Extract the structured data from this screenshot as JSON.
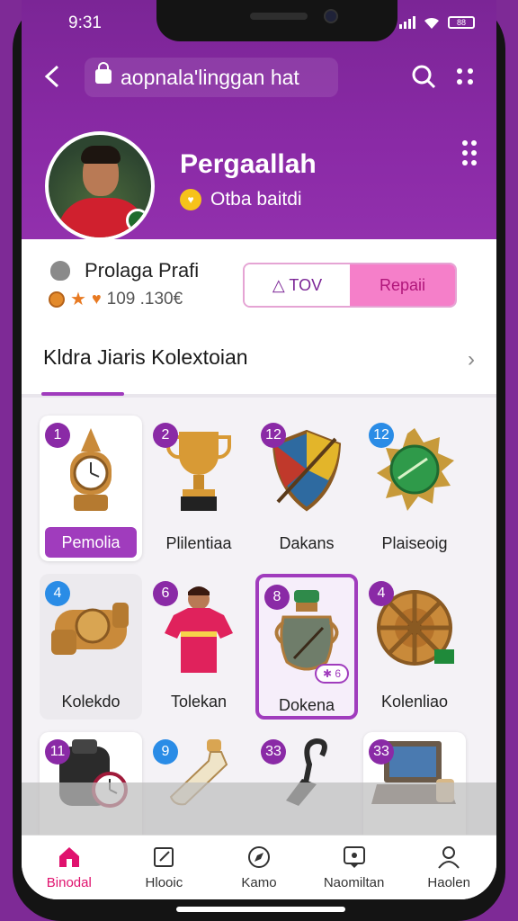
{
  "status_bar": {
    "time": "9:31",
    "battery": "88"
  },
  "browser": {
    "url": "aopnala'linggan hat"
  },
  "profile": {
    "name": "Pergaallah",
    "subtitle": "Otba baitdi"
  },
  "info": {
    "title": "Prolaga Prafi",
    "stats": "109 .130€",
    "button_tov": "TOV",
    "button_repair": "Repaii"
  },
  "section": {
    "title": "Kldra Jiaris Kolextoian"
  },
  "items": [
    {
      "num": "1",
      "label": "Pemolia",
      "badge_color": "#8a2aa6",
      "icon": "clock-trophy-icon"
    },
    {
      "num": "2",
      "label": "Plilentiaa",
      "badge_color": "#8a2aa6",
      "icon": "gold-cup-icon"
    },
    {
      "num": "12",
      "label": "Dakans",
      "badge_color": "#8a2aa6",
      "icon": "shield-icon"
    },
    {
      "num": "12",
      "label": "Plaiseoig",
      "badge_color": "#2a8ce6",
      "icon": "green-medal-icon"
    },
    {
      "num": "4",
      "label": "Kolekdo",
      "badge_color": "#2a8ce6",
      "icon": "bronze-cannon-icon"
    },
    {
      "num": "6",
      "label": "Tolekan",
      "badge_color": "#8a2aa6",
      "icon": "jersey-player-icon"
    },
    {
      "num": "8",
      "label": "Dokena",
      "badge_color": "#8a2aa6",
      "icon": "urn-icon"
    },
    {
      "num": "4",
      "label": "Kolenliao",
      "badge_color": "#8a2aa6",
      "icon": "wheel-icon"
    },
    {
      "num": "11",
      "label": "",
      "badge_color": "#8a2aa6",
      "icon": "helmet-icon"
    },
    {
      "num": "9",
      "label": "",
      "badge_color": "#2a8ce6",
      "icon": "bottle-icon"
    },
    {
      "num": "33",
      "label": "",
      "badge_color": "#8a2aa6",
      "icon": "hook-icon"
    },
    {
      "num": "33",
      "label": "",
      "badge_color": "#8a2aa6",
      "icon": "laptop-icon"
    }
  ],
  "tabs": [
    {
      "label": "Binodal",
      "icon": "home-icon",
      "active": true
    },
    {
      "label": "Hlooic",
      "icon": "edit-icon",
      "active": false
    },
    {
      "label": "Kamo",
      "icon": "compass-icon",
      "active": false
    },
    {
      "label": "Naomiltan",
      "icon": "chat-icon",
      "active": false
    },
    {
      "label": "Haolen",
      "icon": "person-icon",
      "active": false
    }
  ],
  "colors": {
    "brand_purple": "#8a2aa6",
    "accent_pink": "#f57fc9",
    "active_tab": "#e0126e"
  }
}
